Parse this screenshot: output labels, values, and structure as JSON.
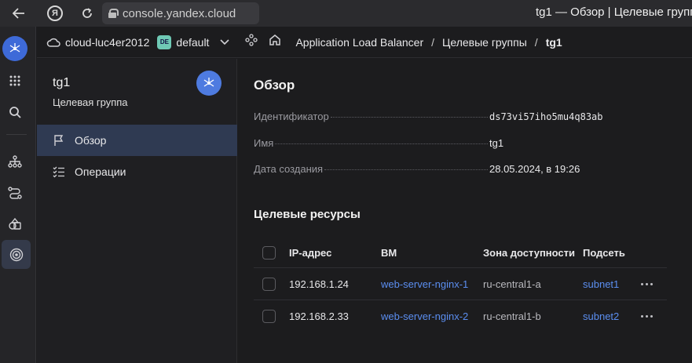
{
  "browser": {
    "url": "console.yandex.cloud",
    "tab_title": "tg1 — Обзор | Целевые группы",
    "yandex_letter": "Я"
  },
  "topbar": {
    "cloud_name": "cloud-luc4er2012",
    "folder_badge": "DE",
    "folder_name": "default",
    "breadcrumbs": [
      "Application Load Balancer",
      "Целевые группы",
      "tg1"
    ]
  },
  "resource": {
    "title": "tg1",
    "subtitle": "Целевая группа",
    "nav": [
      {
        "label": "Обзор",
        "icon": "flag-icon",
        "active": true
      },
      {
        "label": "Операции",
        "icon": "operations-list-icon",
        "active": false
      }
    ]
  },
  "overview": {
    "heading": "Обзор",
    "fields": [
      {
        "key": "Идентификатор",
        "value": "ds73vi57iho5mu4q83ab"
      },
      {
        "key": "Имя",
        "value": "tg1"
      },
      {
        "key": "Дата создания",
        "value": "28.05.2024, в 19:26"
      }
    ]
  },
  "targets": {
    "heading": "Целевые ресурсы",
    "columns": [
      "IP-адрес",
      "ВМ",
      "Зона доступности",
      "Подсеть"
    ],
    "rows": [
      {
        "ip": "192.168.1.24",
        "vm": "web-server-nginx-1",
        "zone": "ru-central1-a",
        "subnet": "subnet1"
      },
      {
        "ip": "192.168.2.33",
        "vm": "web-server-nginx-2",
        "zone": "ru-central1-b",
        "subnet": "subnet2"
      }
    ]
  },
  "colors": {
    "accent": "#3e6ad8",
    "link": "#5b8ef0",
    "active_nav": "#2f3a52",
    "folder_badge": "#6fc9b5"
  }
}
